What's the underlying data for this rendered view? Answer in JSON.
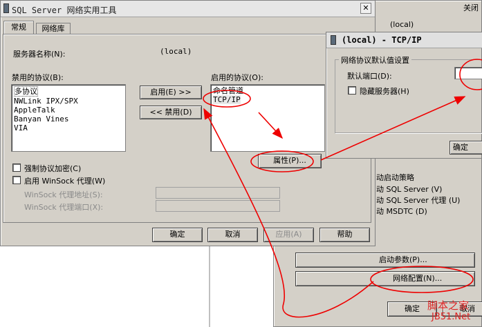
{
  "right_bg": {
    "local_label": "(local)",
    "startup_policy_label": "动启动策略",
    "auto_start": [
      "动 SQL Server (V)",
      "动 SQL Server 代理 (U)",
      "动 MSDTC (D)"
    ],
    "startup_params_button": "启动参数(P)...",
    "net_config_button": "网络配置(N)...",
    "ok_button": "确定",
    "cancel_button": "取消",
    "corner_text": "关闭"
  },
  "main": {
    "title": "SQL Server 网络实用工具",
    "close_glyph": "✕",
    "tabs": [
      "常规",
      "网络库"
    ],
    "server_name_label": "服务器名称(N):",
    "server_name_value": "(local)",
    "disabled_protocols_label": "禁用的协议(B):",
    "disabled_protocols": [
      "多协议",
      "NWLink IPX/SPX",
      "AppleTalk",
      "Banyan Vines",
      "VIA"
    ],
    "enabled_protocols_label": "启用的协议(O):",
    "enabled_protocols": [
      "命名管道",
      "TCP/IP"
    ],
    "enable_button": "启用(E) >>",
    "disable_button": "<< 禁用(D)",
    "properties_button": "属性(P)...",
    "force_encryption_label": "强制协议加密(C)",
    "enable_winsock_label": "启用 WinSock 代理(W)",
    "winsock_addr_label": "WinSock 代理地址(S):",
    "winsock_port_label": "WinSock 代理端口(X):",
    "ok_button": "确定",
    "cancel_button": "取消",
    "apply_button": "应用(A)",
    "help_button": "帮助"
  },
  "tcp": {
    "title": "(local) - TCP/IP",
    "group_label": "网络协议默认值设置",
    "default_port_label": "默认端口(D):",
    "hide_server_label": "隐藏服务器(H)",
    "ok_button_partial": "确定"
  },
  "watermark": {
    "line1": "脚本之家",
    "line2": "JB51.Net"
  },
  "colors": {
    "dialog_bg": "#d4d0c8",
    "annotation_red": "#ee0000",
    "watermark_red": "#dd2222"
  }
}
